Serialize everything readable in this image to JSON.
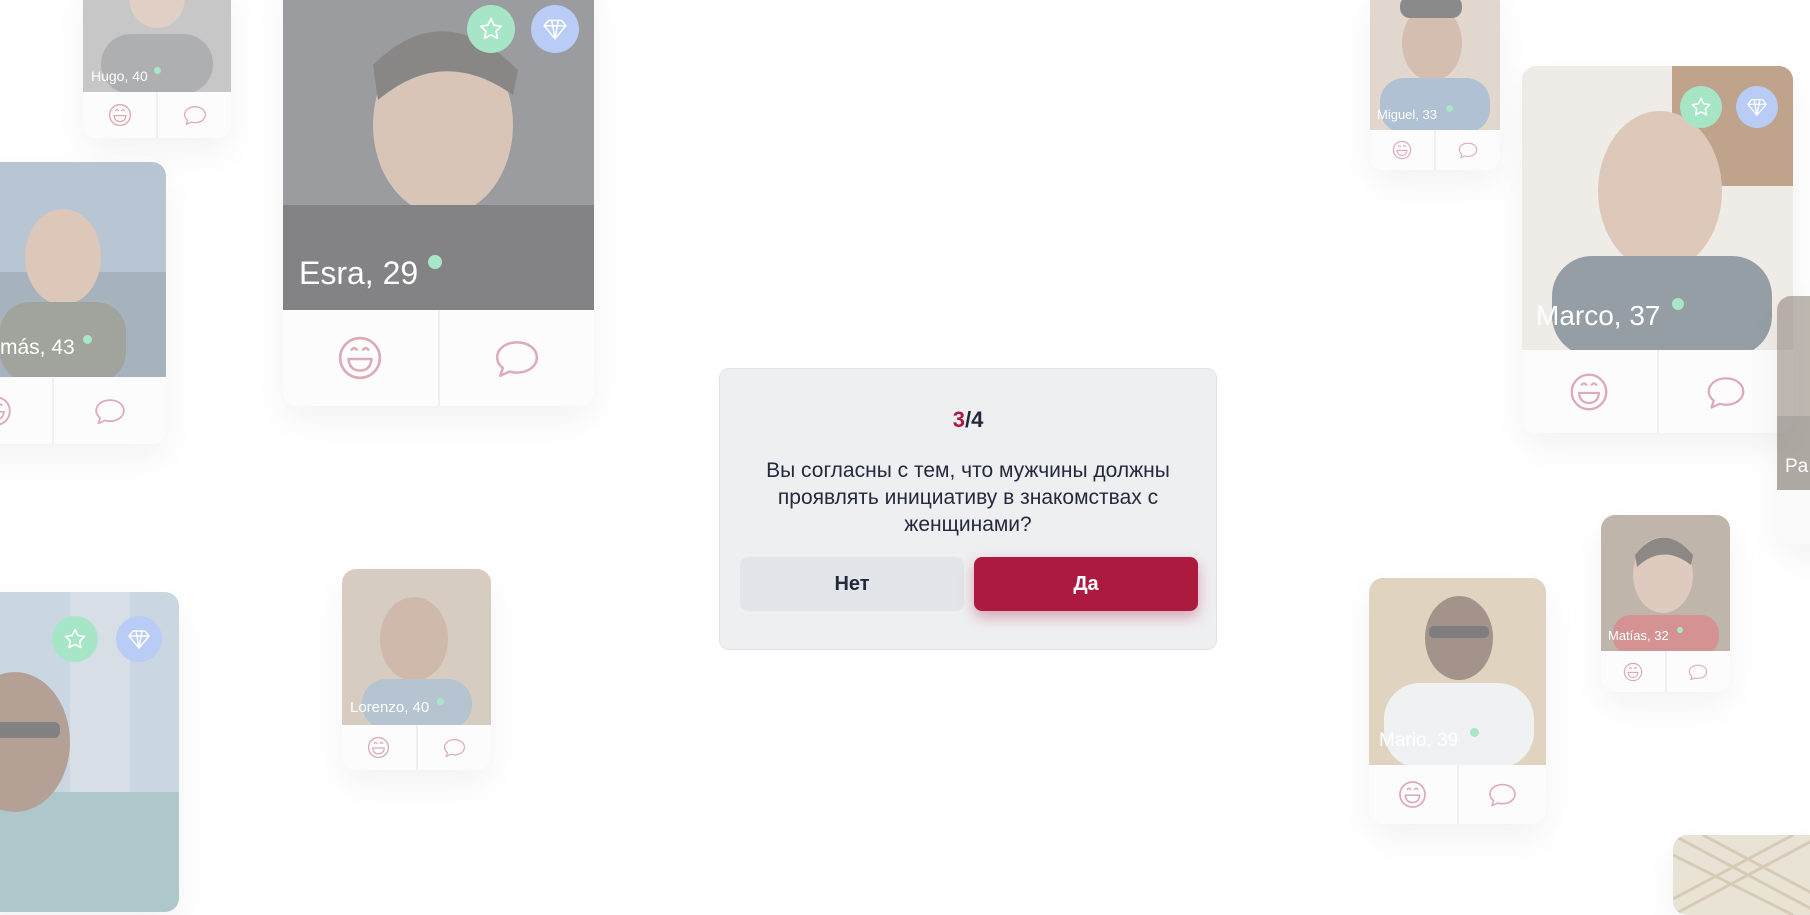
{
  "quiz": {
    "current": "3",
    "separator": "/",
    "total": "4",
    "question": "Вы согласны с тем, что мужчины должны проявлять инициативу в знакомствах с женщинами?",
    "no_label": "Нет",
    "yes_label": "Да"
  },
  "profiles": [
    {
      "name": "Hugo, 40",
      "online": true
    },
    {
      "name": "Esra, 29",
      "online": true,
      "badges": [
        "star-icon",
        "diamond-icon"
      ]
    },
    {
      "name": "más, 43",
      "online": true
    },
    {
      "name": "",
      "online": false,
      "badges": [
        "star-icon",
        "diamond-icon"
      ]
    },
    {
      "name": "Lorenzo, 40",
      "online": true
    },
    {
      "name": "Miguel, 33",
      "online": true
    },
    {
      "name": "Marco, 37",
      "online": true,
      "badges": [
        "star-icon",
        "diamond-icon"
      ]
    },
    {
      "name": "Pa",
      "online": false
    },
    {
      "name": "Matías, 32",
      "online": true
    },
    {
      "name": "Mario, 39",
      "online": true
    }
  ],
  "card_actions": {
    "like_icon": "smile-icon",
    "message_icon": "chat-bubble-icon"
  },
  "colors": {
    "accent": "#ad1a3f",
    "online_dot": "#61d39a",
    "star_badge": "#5fd39a",
    "diamond_badge": "#7fa3ee",
    "action_icon": "#c0687e",
    "text_dark": "#232a3c"
  }
}
